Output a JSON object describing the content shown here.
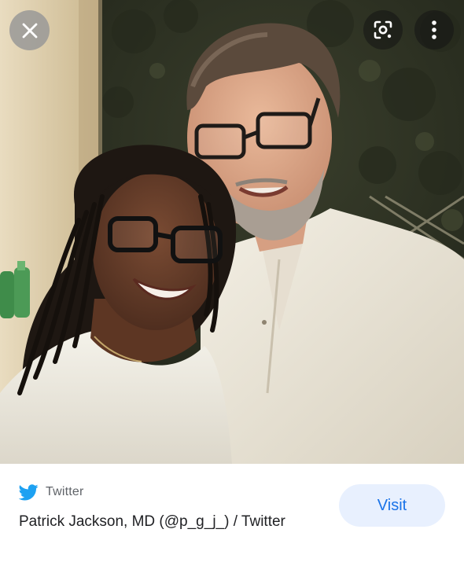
{
  "toolbar": {
    "close_icon": "close-icon",
    "lens_icon": "google-lens-icon",
    "more_icon": "more-vert-icon"
  },
  "image": {
    "subject": "photo-of-two-people"
  },
  "result": {
    "source_icon": "twitter-bird-icon",
    "source_name": "Twitter",
    "title": "Patrick Jackson, MD (@p_g_j_) / Twitter",
    "visit_label": "Visit"
  },
  "colors": {
    "twitter_blue": "#1da1f2",
    "visit_text": "#1a73e8",
    "visit_bg": "#e8f0fe"
  }
}
